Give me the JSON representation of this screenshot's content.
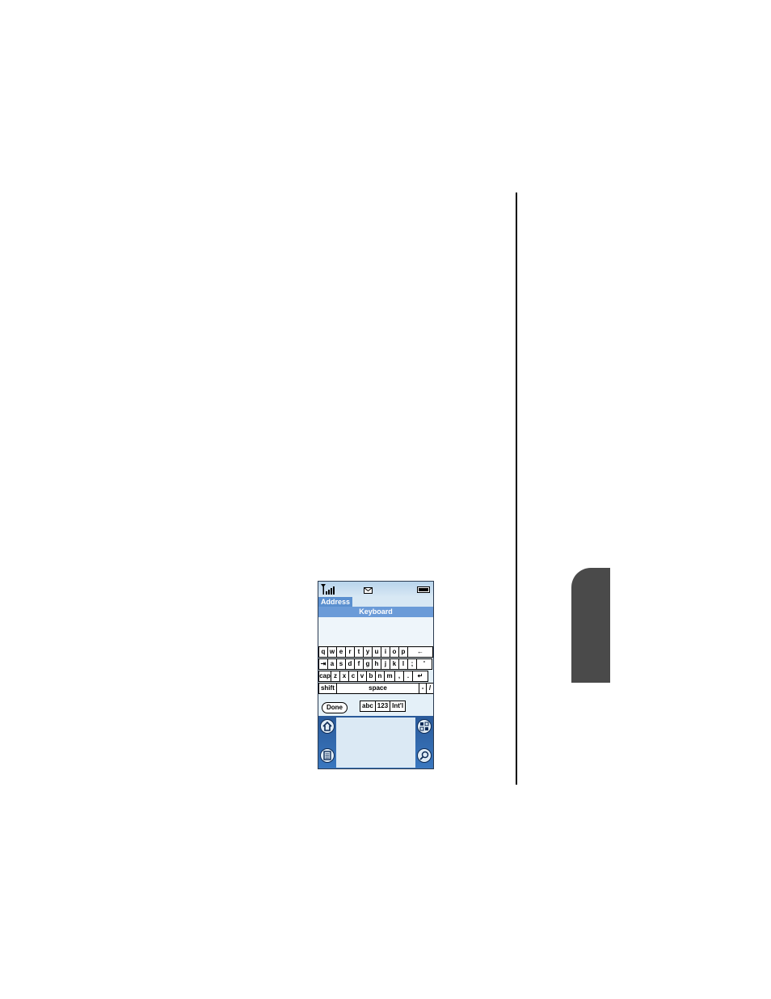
{
  "device": {
    "app_title": "Address",
    "keyboard_title": "Keyboard",
    "keyboard": {
      "row1": [
        "q",
        "w",
        "e",
        "r",
        "t",
        "y",
        "u",
        "i",
        "o",
        "p",
        "←"
      ],
      "row2": [
        "⇥",
        "a",
        "s",
        "d",
        "f",
        "g",
        "h",
        "j",
        "k",
        "l",
        ";",
        "'"
      ],
      "row3": [
        "cap",
        "z",
        "x",
        "c",
        "v",
        "b",
        "n",
        "m",
        ",",
        ".",
        "↵"
      ],
      "row4": [
        "shift",
        "space",
        "-",
        "/"
      ]
    },
    "done_label": "Done",
    "modes": [
      "abc",
      "123",
      "Int'l"
    ]
  },
  "colors": {
    "title_bar": "#6b9bd8",
    "page_tab": "#4a4a4a",
    "screen_bottom": "#2a5a9a"
  }
}
